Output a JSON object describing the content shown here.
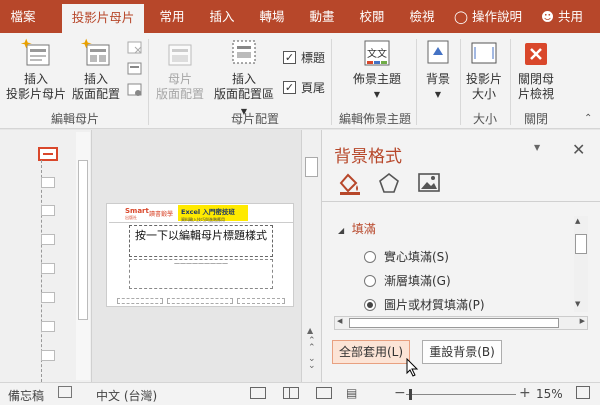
{
  "tabs": [
    {
      "label": "檔案"
    },
    {
      "label": "投影片母片"
    },
    {
      "label": "常用"
    },
    {
      "label": "插入"
    },
    {
      "label": "轉場"
    },
    {
      "label": "動畫"
    },
    {
      "label": "校閱"
    },
    {
      "label": "檢視"
    }
  ],
  "tell_me": "操作說明",
  "share": "共用",
  "ribbon": {
    "insert_master": [
      "插入",
      "投影片母片"
    ],
    "insert_layout": [
      "插入",
      "版面配置"
    ],
    "edit_master_group": "編輯母片",
    "master_layout": [
      "母片",
      "版面配置"
    ],
    "insert_placeholder": [
      "插入",
      "版面配置區"
    ],
    "title_check": "標題",
    "footer_check": "頁尾",
    "master_layout_group": "母片配置",
    "themes": "佈景主題",
    "themes_icon_text": "文文",
    "edit_theme_group": "編輯佈景主題",
    "background": "背景",
    "slide_size": [
      "投影片",
      "大小"
    ],
    "size_group": "大小",
    "close_master": [
      "關閉母",
      "片檢視"
    ],
    "close_group": "關閉"
  },
  "slide": {
    "logo_smart": "Smart",
    "logo_sub": "出版社",
    "logo_text": "讀書鍛學",
    "banner": "Excel 入門密技班",
    "banner_sub": "資料輸入技巧與進階應用",
    "title_placeholder": "按一下以編輯母片標題樣式",
    "subtitle_line": "—————————"
  },
  "panel": {
    "title": "背景格式",
    "section": "填滿",
    "options": [
      "實心填滿(S)",
      "漸層填滿(G)",
      "圖片或材質填滿(P)"
    ],
    "selected_index": 2,
    "apply_all": "全部套用(L)",
    "reset": "重設背景(B)"
  },
  "status": {
    "notes": "備忘稿",
    "language": "中文 (台灣)",
    "zoom": "15%"
  },
  "colors": {
    "accent": "#b7472a",
    "close_btn": "#d9472b"
  }
}
